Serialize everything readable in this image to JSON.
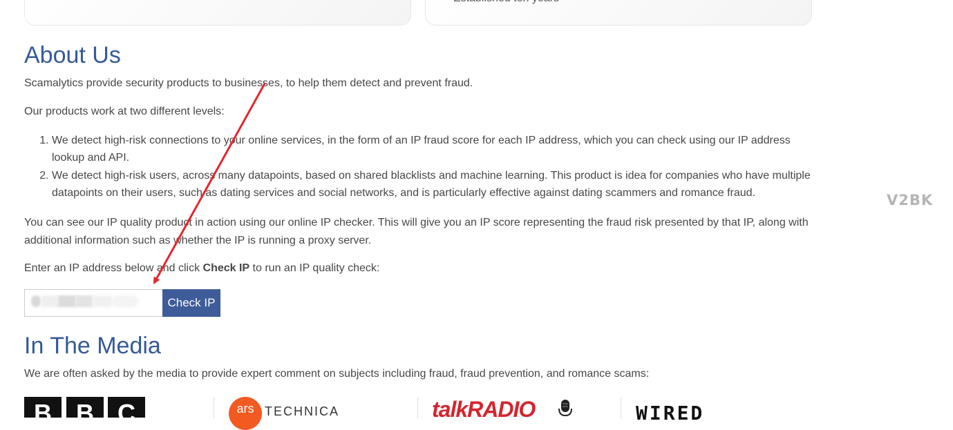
{
  "top_card": {
    "bullet": "Established ten years"
  },
  "about": {
    "heading": "About Us",
    "intro": "Scamalytics provide security products to businesses, to help them detect and prevent fraud.",
    "levels_intro": "Our products work at two different levels:",
    "levels": [
      "We detect high-risk connections to your online services, in the form of an IP fraud score for each IP address, which you can check using our IP address lookup and API.",
      "We detect high-risk users, across many datapoints, based on shared blacklists and machine learning. This product is idea for companies who have multiple datapoints on their users, such as dating services and social networks, and is particularly effective against dating scammers and romance fraud."
    ],
    "see": "You can see our IP quality product in action using our online IP checker. This will give you an IP score representing the fraud risk presented by that IP, along with additional information such as whether the IP is running a proxy server.",
    "enter_before": "Enter an IP address below and click ",
    "enter_bold": "Check IP",
    "enter_after": " to run an IP quality check:"
  },
  "ip_form": {
    "input_value": "",
    "button_label": "Check IP"
  },
  "media": {
    "heading": "In The Media",
    "text": "We are often asked by the media to provide expert comment on subjects including fraud, fraud prevention, and romance scams:",
    "logos": {
      "bbc": [
        "B",
        "B",
        "C"
      ],
      "ars_mark": "ars",
      "ars_text": "TECHNICA",
      "talkradio": "talkRADIO",
      "wired": "WIRED"
    }
  },
  "watermark": "V2BK",
  "colors": {
    "heading": "#35599a",
    "button": "#3d5c99",
    "annotation_arrow": "#e3262e"
  },
  "icons": {
    "microphone": "mic-icon",
    "annotation": "arrow-annotation-icon"
  }
}
